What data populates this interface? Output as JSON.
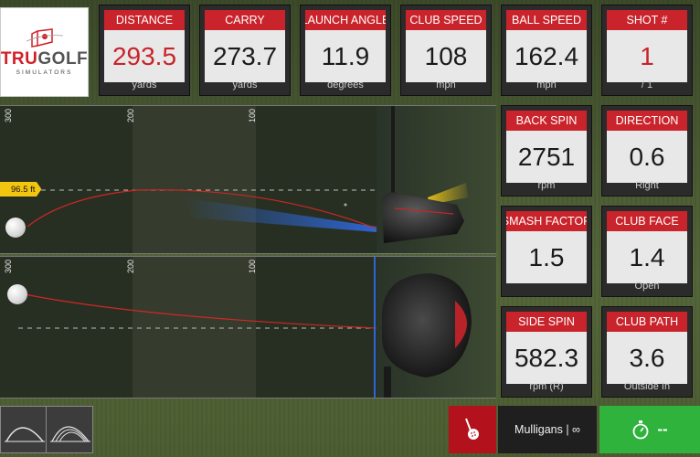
{
  "logo": {
    "brand_red": "TRU",
    "brand_gray": "GOLF",
    "subtitle": "SIMULATORS"
  },
  "stats": {
    "distance": {
      "label": "DISTANCE",
      "value": "293.5",
      "unit": "yards"
    },
    "carry": {
      "label": "CARRY",
      "value": "273.7",
      "unit": "yards"
    },
    "launch_angle": {
      "label": "LAUNCH ANGLE",
      "value": "11.9",
      "unit": "degrees"
    },
    "club_speed": {
      "label": "CLUB SPEED",
      "value": "108",
      "unit": "mph"
    },
    "ball_speed": {
      "label": "BALL SPEED",
      "value": "162.4",
      "unit": "mph"
    },
    "shot_number": {
      "label": "SHOT #",
      "value": "1",
      "unit": "/ 1"
    },
    "back_spin": {
      "label": "BACK SPIN",
      "value": "2751",
      "unit": "rpm"
    },
    "direction": {
      "label": "DIRECTION",
      "value": "0.6",
      "unit": "Right"
    },
    "smash_factor": {
      "label": "SMASH FACTOR",
      "value": "1.5",
      "unit": ""
    },
    "club_face": {
      "label": "CLUB FACE",
      "value": "1.4",
      "unit": "Open"
    },
    "side_spin": {
      "label": "SIDE SPIN",
      "value": "582.3",
      "unit": "rpm (R)"
    },
    "club_path": {
      "label": "CLUB PATH",
      "value": "3.6",
      "unit": "Outside In"
    }
  },
  "side_view": {
    "yard_markers": [
      "300",
      "200",
      "100"
    ],
    "apex_height": "96.5 ft"
  },
  "top_view": {
    "yard_markers": [
      "300",
      "200",
      "100"
    ]
  },
  "bottom_bar": {
    "mulligans_label": "Mulligans | ∞",
    "timer_value": "--"
  },
  "colors": {
    "header_red": "#c9232b",
    "accent_green": "#2fb33c",
    "apex_tag": "#f2c511",
    "trajectory": "#d22626"
  },
  "icons": {
    "view_side": "arc-trajectory-icon",
    "view_multi": "multi-arc-icon",
    "putt": "putting-icon",
    "timer": "stopwatch-icon"
  }
}
